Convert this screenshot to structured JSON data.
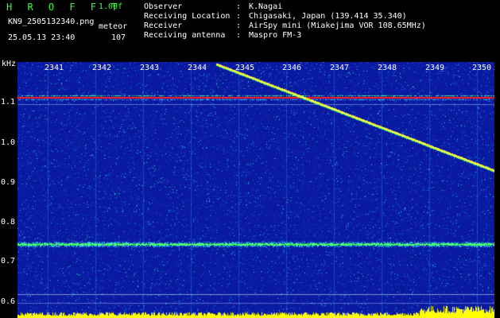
{
  "header": {
    "app_title": "H R O F F T",
    "version": "1.00f",
    "filename": "KN9_2505132340.png",
    "meteor_label": "meteor",
    "datetime": "25.05.13 23:40",
    "meteor_count": "107"
  },
  "info": [
    {
      "key": "Observer",
      "value": "K.Nagai"
    },
    {
      "key": "Receiving Location",
      "value": "Chigasaki, Japan (139.414 35.340)"
    },
    {
      "key": "Receiver",
      "value": "AirSpy mini (Miakejima VOR 108.65MHz)"
    },
    {
      "key": "Receiving antenna",
      "value": "Maspro FM-3"
    }
  ],
  "info_separator": ":",
  "axis": {
    "unit": "kHz",
    "y_labels": [
      "1.1",
      "1.0",
      "0.9",
      "0.8",
      "0.7",
      "0.6"
    ],
    "x_labels": [
      "2341",
      "2342",
      "2343",
      "2344",
      "2345",
      "2346",
      "2347",
      "2348",
      "2349",
      "2350"
    ]
  },
  "colors": {
    "background": "#000000",
    "spectrum_base": "#0a1aa0",
    "title_green": "#33ff33",
    "carrier_red": "#ff2020",
    "meteor_trail": "#ffff40",
    "power_bar": "#ffff00"
  }
}
